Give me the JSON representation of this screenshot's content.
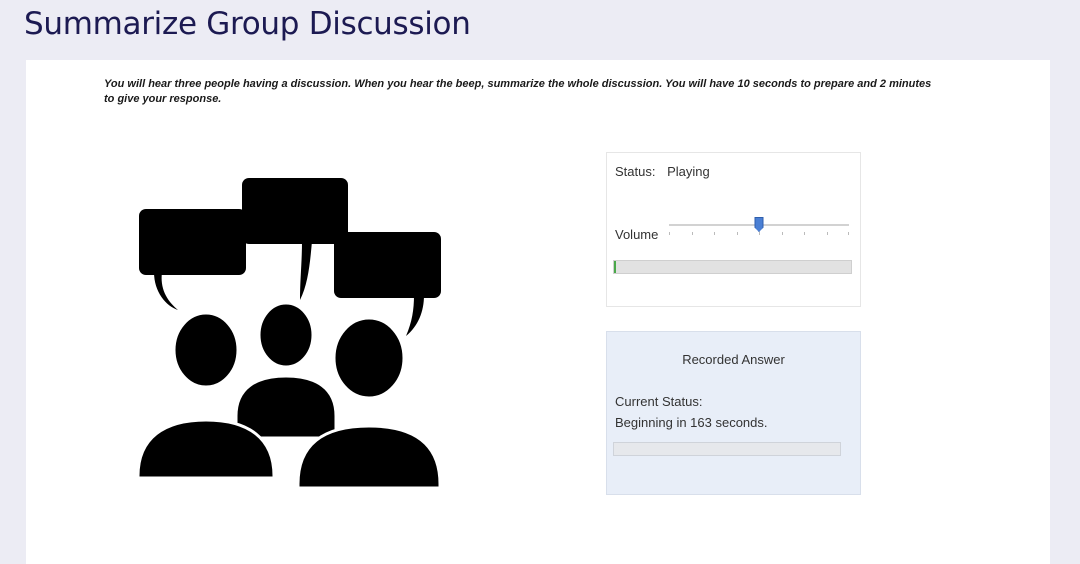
{
  "page": {
    "title": "Summarize Group Discussion"
  },
  "instructions": {
    "text": "You will hear three people having a discussion. When you hear the beep, summarize the whole discussion. You will have 10 seconds to prepare and 2 minutes to give your response."
  },
  "image": {
    "icon": "group-discussion-icon"
  },
  "audio_player": {
    "status_label": "Status:",
    "status_value": "Playing",
    "volume_label": "Volume",
    "volume_level": 0.5,
    "playback_progress": 0.01,
    "accent_color": "#4aa84a",
    "thumb_color": "#4a7fd4"
  },
  "recorder": {
    "title": "Recorded Answer",
    "current_status_label": "Current Status:",
    "countdown_text": "Beginning in 163 seconds.",
    "progress": 0
  },
  "colors": {
    "title": "#1c1a52",
    "page_background": "#ececf4",
    "recorder_background": "#e8eef8"
  }
}
